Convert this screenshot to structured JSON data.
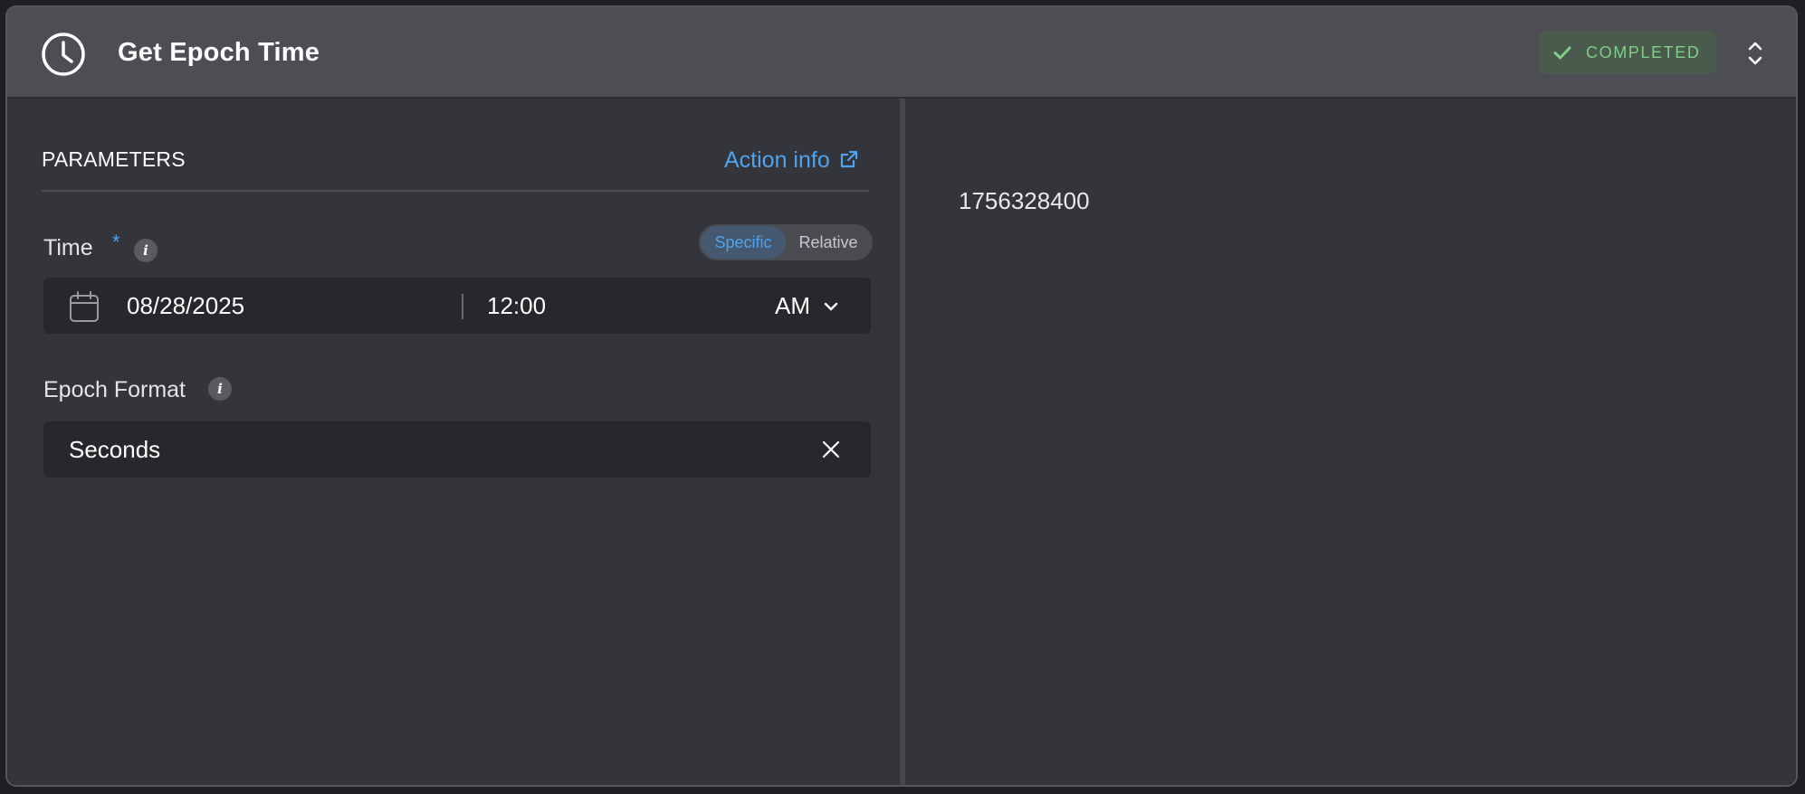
{
  "header": {
    "title": "Get Epoch Time",
    "status": "COMPLETED",
    "status_color": "#7fce8a"
  },
  "parameters": {
    "title": "PARAMETERS",
    "action_info": "Action info",
    "time": {
      "label": "Time",
      "required_marker": "*",
      "info_glyph": "i",
      "mode_options": [
        "Specific",
        "Relative"
      ],
      "mode_selected": "Specific",
      "date": "08/28/2025",
      "time": "12:00",
      "meridiem": "AM"
    },
    "epoch_format": {
      "label": "Epoch Format",
      "info_glyph": "i",
      "value": "Seconds"
    }
  },
  "output": {
    "value": "1756328400"
  },
  "colors": {
    "accent": "#4ea3f1",
    "header_bg": "#4d4e53",
    "panel_bg": "#34353a",
    "field_bg": "#27282c"
  }
}
